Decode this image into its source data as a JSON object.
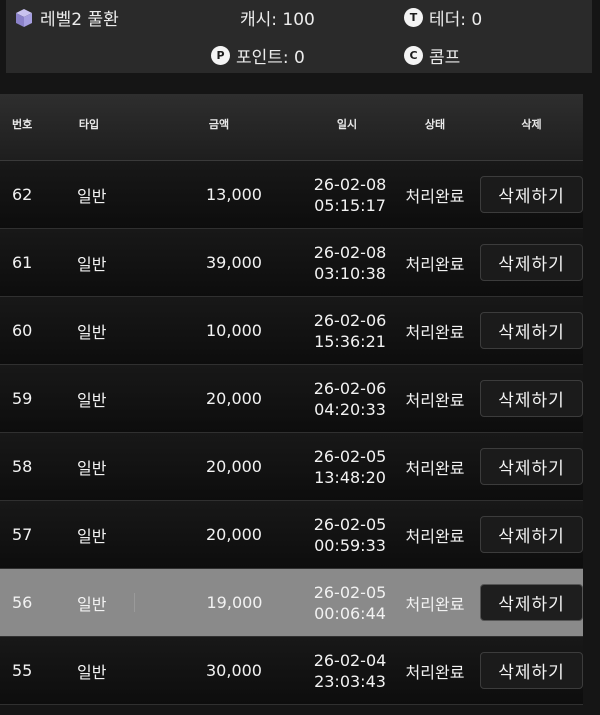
{
  "summary": {
    "level": "레벨2 풀환",
    "cash": "캐시: 100",
    "tether": "테더: 0",
    "point": "포인트: 0",
    "comp": "콤프",
    "tether_icon_letter": "T",
    "point_icon_letter": "P",
    "comp_icon_letter": "C"
  },
  "table": {
    "headers": {
      "no": "번호",
      "type": "타입",
      "amount": "금액",
      "datetime": "일시",
      "status": "상태",
      "delete": "삭제"
    },
    "rows": [
      {
        "no": "62",
        "type": "일반",
        "amount": "13,000",
        "date": "26-02-08",
        "time": "05:15:17",
        "status": "처리완료",
        "action": "삭제하기"
      },
      {
        "no": "61",
        "type": "일반",
        "amount": "39,000",
        "date": "26-02-08",
        "time": "03:10:38",
        "status": "처리완료",
        "action": "삭제하기"
      },
      {
        "no": "60",
        "type": "일반",
        "amount": "10,000",
        "date": "26-02-06",
        "time": "15:36:21",
        "status": "처리완료",
        "action": "삭제하기"
      },
      {
        "no": "59",
        "type": "일반",
        "amount": "20,000",
        "date": "26-02-06",
        "time": "04:20:33",
        "status": "처리완료",
        "action": "삭제하기"
      },
      {
        "no": "58",
        "type": "일반",
        "amount": "20,000",
        "date": "26-02-05",
        "time": "13:48:20",
        "status": "처리완료",
        "action": "삭제하기"
      },
      {
        "no": "57",
        "type": "일반",
        "amount": "20,000",
        "date": "26-02-05",
        "time": "00:59:33",
        "status": "처리완료",
        "action": "삭제하기"
      },
      {
        "no": "56",
        "type": "일반",
        "amount": "19,000",
        "date": "26-02-05",
        "time": "00:06:44",
        "status": "처리완료",
        "action": "삭제하기"
      },
      {
        "no": "55",
        "type": "일반",
        "amount": "30,000",
        "date": "26-02-04",
        "time": "23:03:43",
        "status": "처리완료",
        "action": "삭제하기"
      }
    ]
  },
  "colors": {
    "highlight_row": "#8a8a8a",
    "panel": "#2a2a2a",
    "background": "#151515"
  }
}
